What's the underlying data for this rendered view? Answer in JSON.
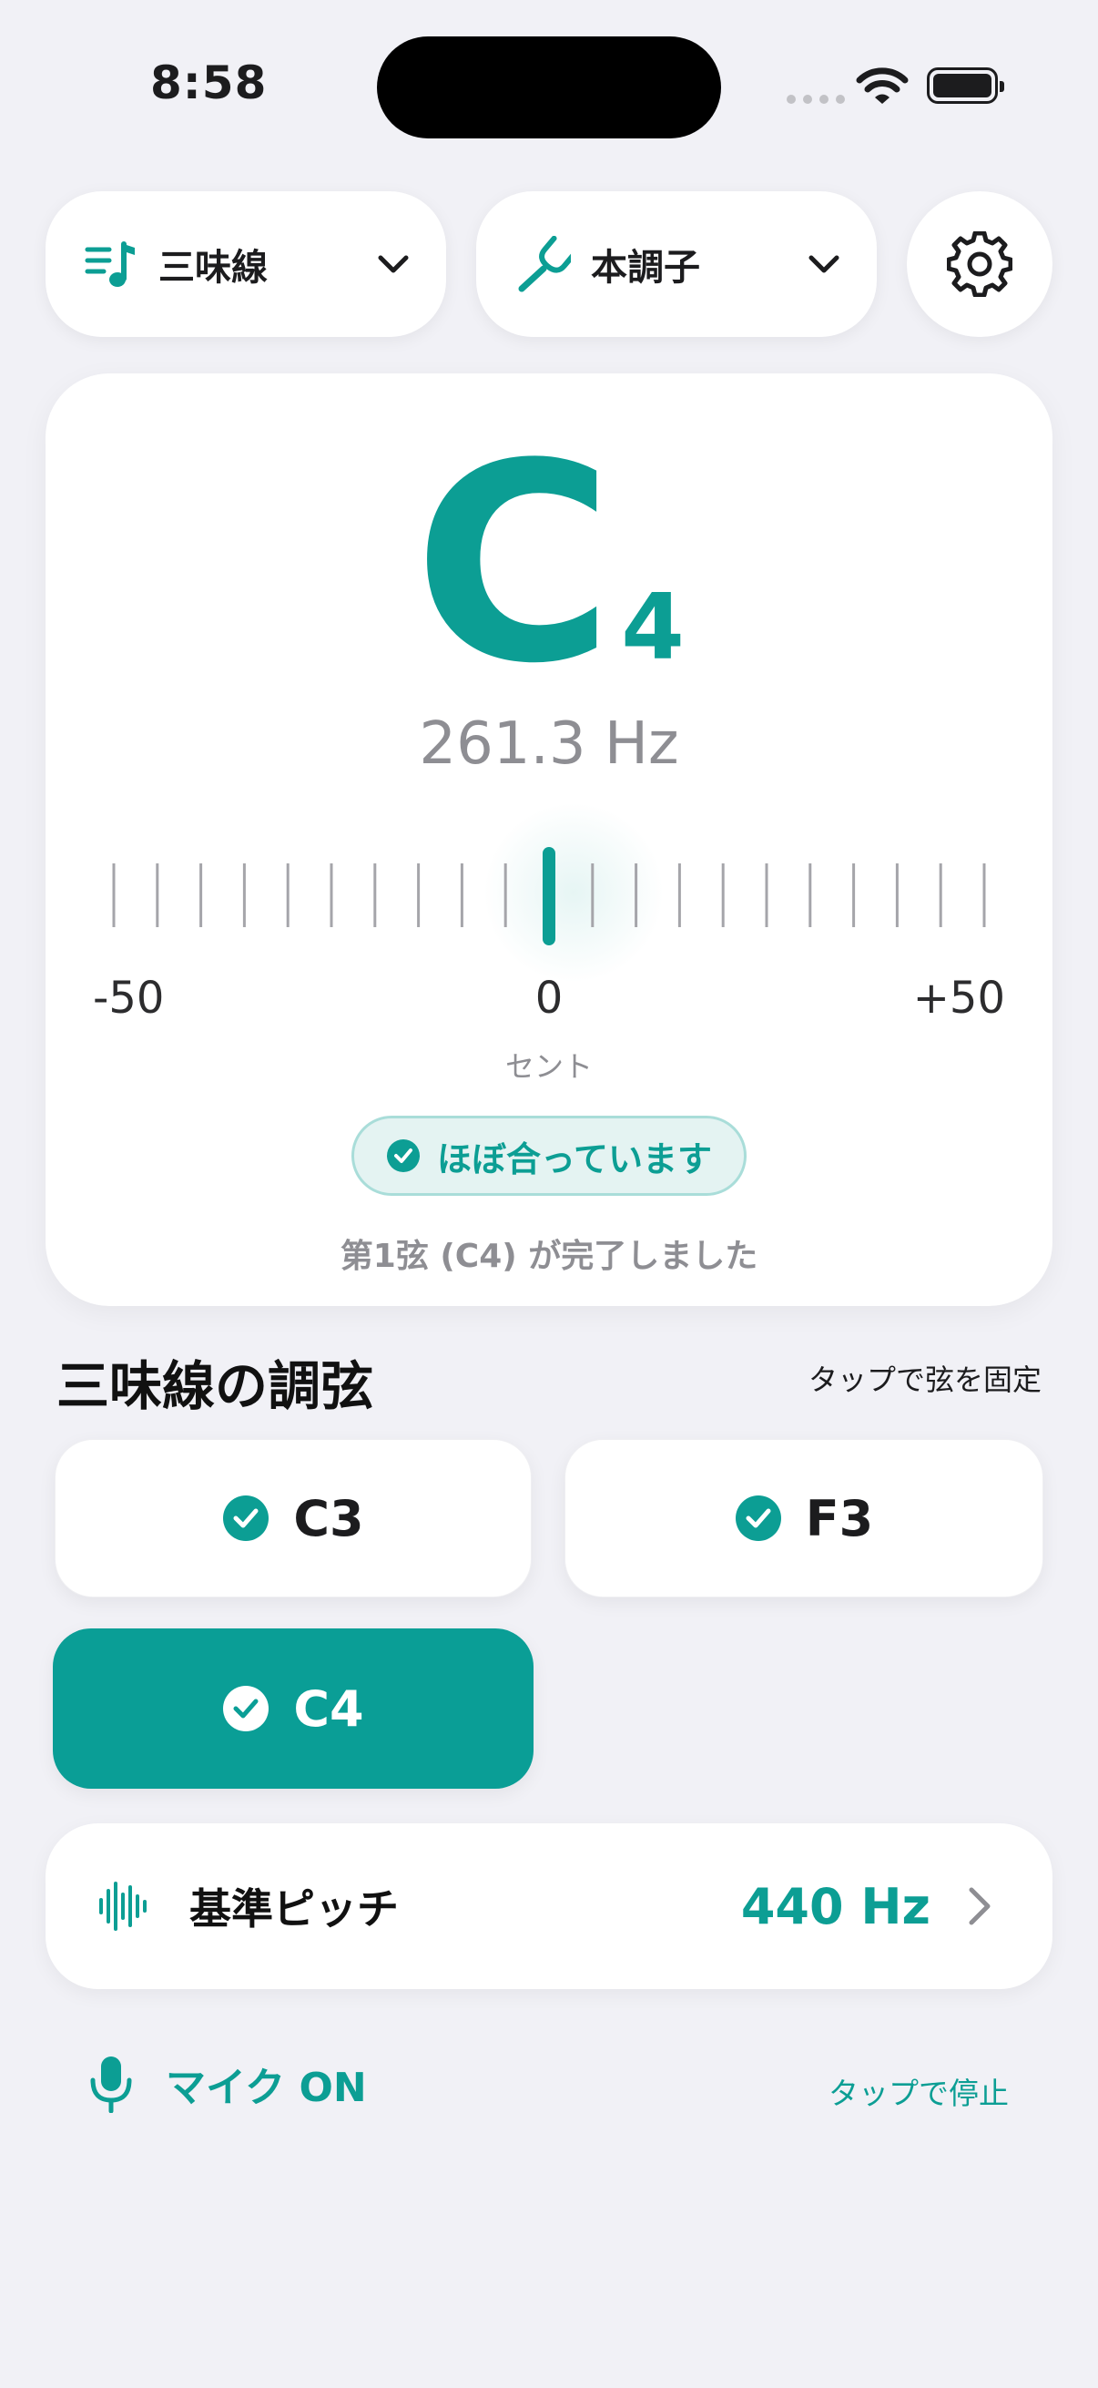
{
  "status_bar": {
    "time": "8:58"
  },
  "toolbar": {
    "instrument": {
      "label": "三味線",
      "icon": "music-list-icon"
    },
    "tuning": {
      "label": "本調子",
      "icon": "tuning-fork-icon"
    },
    "settings_icon": "gear-icon"
  },
  "tuner": {
    "note_letter": "C",
    "note_octave": "4",
    "frequency": "261.3 Hz",
    "cents_offset": 0,
    "scale": {
      "min_label": "-50",
      "mid_label": "0",
      "max_label": "+50",
      "unit": "セント"
    },
    "status": "ほぼ合っています",
    "completion": "第1弦 (C4) が完了しました"
  },
  "strings_section": {
    "title": "三味線の調弦",
    "hint": "タップで弦を固定",
    "strings": [
      {
        "name": "C3",
        "done": true,
        "selected": false
      },
      {
        "name": "F3",
        "done": true,
        "selected": false
      },
      {
        "name": "C4",
        "done": true,
        "selected": true
      }
    ]
  },
  "reference_pitch": {
    "label": "基準ピッチ",
    "value": "440 Hz"
  },
  "mic": {
    "label": "マイク ON",
    "hint": "タップで停止"
  },
  "colors": {
    "accent": "#0C9E94",
    "background": "#F1F1F6",
    "card": "#FFFFFF",
    "muted": "#8E8E93"
  }
}
